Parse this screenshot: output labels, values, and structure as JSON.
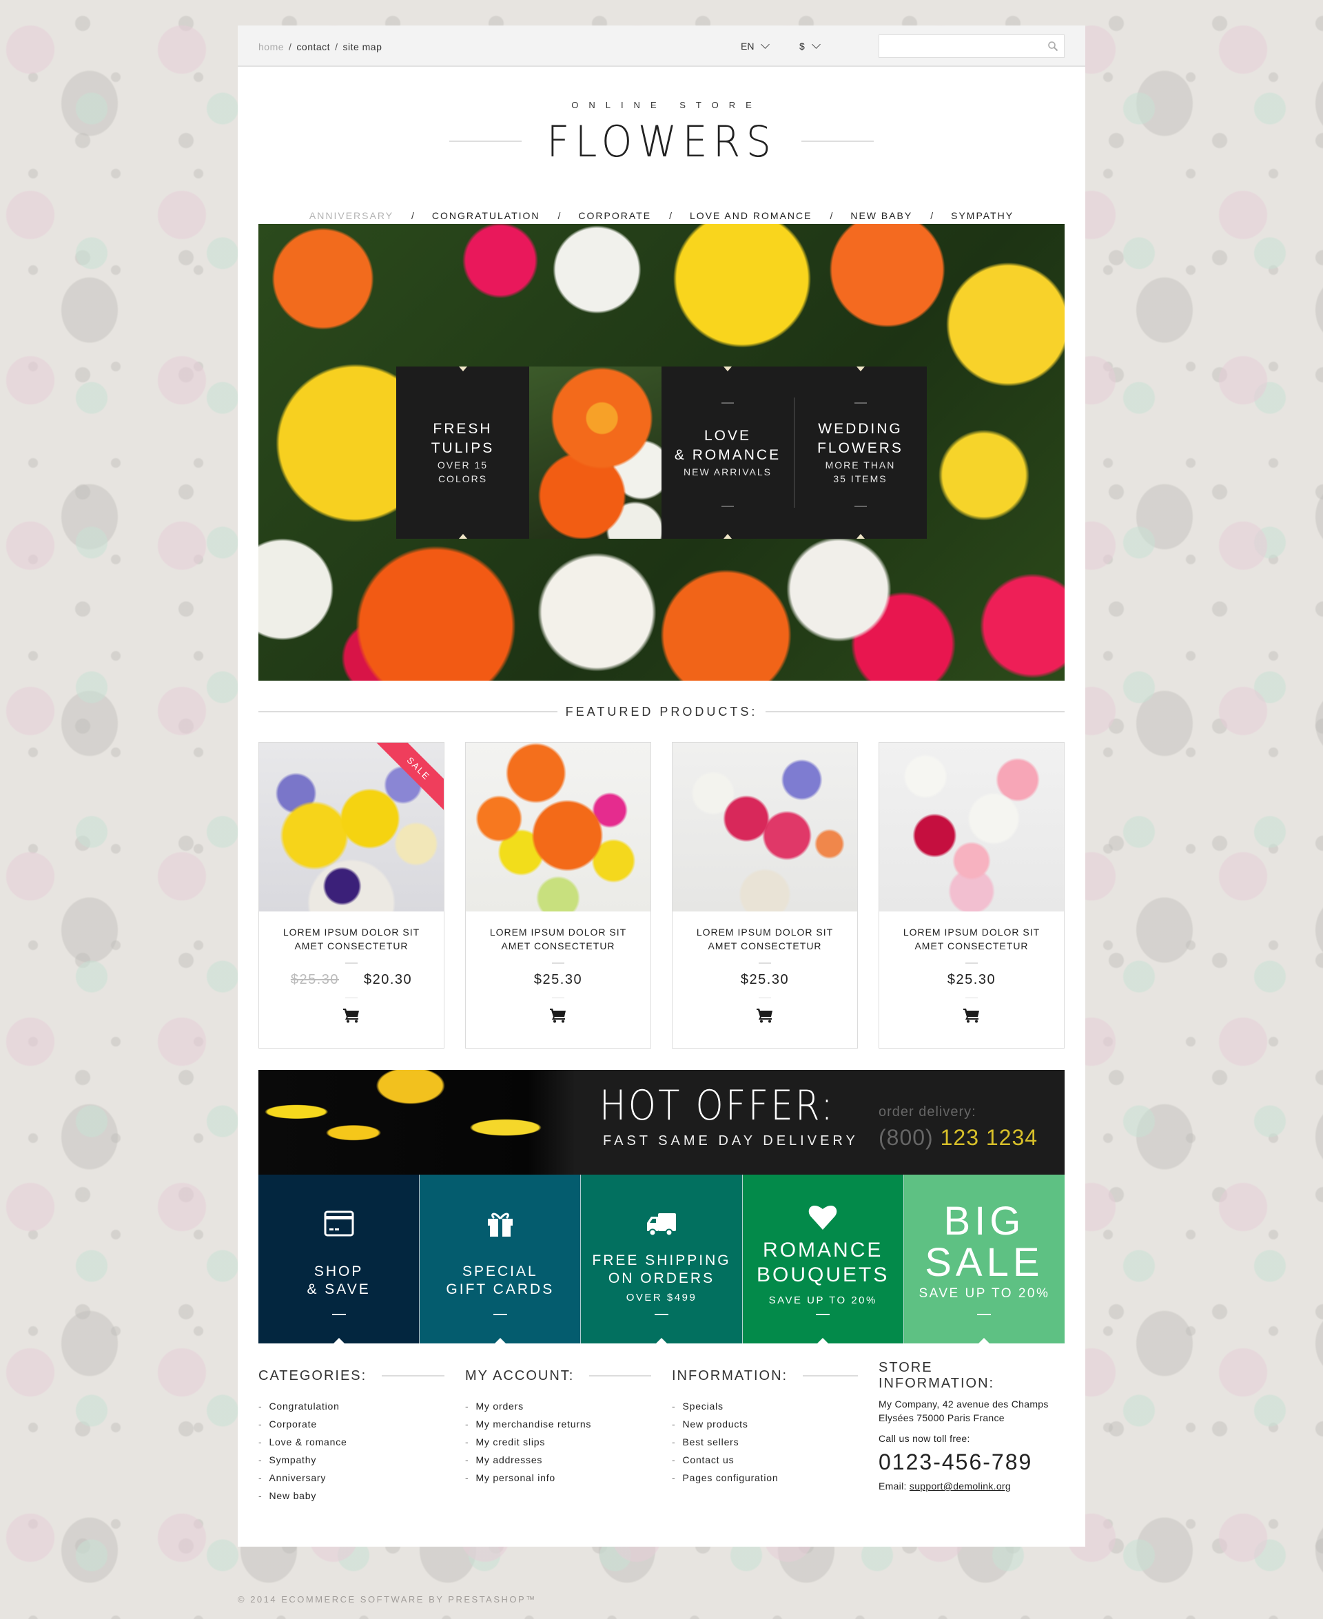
{
  "topbar": {
    "links": [
      {
        "label": "home",
        "active": true
      },
      {
        "label": "contact"
      },
      {
        "label": "site map"
      }
    ],
    "separator": "/",
    "language": "EN",
    "currency": "$",
    "search": {
      "value": "",
      "placeholder": ""
    }
  },
  "logo": {
    "subtitle": "ONLINE STORE",
    "title": "FLOWERS"
  },
  "nav": {
    "separator": "/",
    "items": [
      {
        "label": "ANNIVERSARY",
        "active": true
      },
      {
        "label": "CONGRATULATION"
      },
      {
        "label": "CORPORATE"
      },
      {
        "label": "LOVE AND ROMANCE"
      },
      {
        "label": "NEW BABY"
      },
      {
        "label": "SYMPATHY"
      }
    ]
  },
  "hero": {
    "banners": [
      {
        "title1": "FRESH",
        "title2": "TULIPS",
        "sub1": "OVER 15",
        "sub2": "COLORS"
      },
      {
        "title1": "LOVE",
        "title2": "& ROMANCE",
        "sub1": "NEW ARRIVALS",
        "sub2": ""
      },
      {
        "title1": "WEDDING",
        "title2": "FLOWERS",
        "sub1": "MORE THAN",
        "sub2": "35 ITEMS"
      }
    ]
  },
  "featured": {
    "title": "FEATURED PRODUCTS:",
    "products": [
      {
        "name1": "LOREM IPSUM DOLOR SIT",
        "name2": "AMET CONSECTETUR",
        "old_price": "$25.30",
        "price": "$20.30",
        "badge": "SALE"
      },
      {
        "name1": "LOREM IPSUM DOLOR SIT",
        "name2": "AMET CONSECTETUR",
        "price": "$25.30"
      },
      {
        "name1": "LOREM IPSUM DOLOR SIT",
        "name2": "AMET CONSECTETUR",
        "price": "$25.30"
      },
      {
        "name1": "LOREM IPSUM DOLOR SIT",
        "name2": "AMET CONSECTETUR",
        "price": "$25.30"
      }
    ]
  },
  "hot_offer": {
    "title": "HOT OFFER:",
    "subtitle": "FAST SAME DAY DELIVERY",
    "order_label": "order delivery:",
    "phone_area": "(800)",
    "phone_number": "123 1234",
    "phone_color": "#d8c02a"
  },
  "tiles": [
    {
      "icon": "credit-card-icon",
      "line1": "SHOP",
      "line2": "& SAVE",
      "sub": "",
      "color": "#03263f"
    },
    {
      "icon": "gift-icon",
      "line1": "SPECIAL",
      "line2": "GIFT CARDS",
      "sub": "",
      "color": "#045c6e"
    },
    {
      "icon": "truck-icon",
      "line1": "FREE SHIPPING",
      "line2": "ON ORDERS",
      "sub": "OVER $499",
      "color": "#02705f"
    },
    {
      "icon": "heart-icon",
      "line1": "ROMANCE",
      "line2": "BOUQUETS",
      "sub": "SAVE UP TO 20%",
      "color": "#038a4a"
    },
    {
      "icon": "",
      "line1": "BIG",
      "line2": "SALE",
      "sub": "SAVE UP TO 20%",
      "color": "#5ec183"
    }
  ],
  "footer": {
    "categories": {
      "title": "CATEGORIES:",
      "items": [
        "Congratulation",
        "Corporate",
        "Love & romance",
        "Sympathy",
        "Anniversary",
        "New baby"
      ]
    },
    "account": {
      "title": "MY ACCOUNT:",
      "items": [
        "My orders",
        "My merchandise returns",
        "My credit slips",
        "My addresses",
        "My personal info"
      ]
    },
    "information": {
      "title": "INFORMATION:",
      "items": [
        "Specials",
        "New products",
        "Best sellers",
        "Contact us",
        "Pages configuration"
      ]
    },
    "store": {
      "title": "STORE INFORMATION:",
      "address1": "My Company, 42 avenue des Champs",
      "address2": "Elysées 75000 Paris France",
      "call_label": "Call us now toll free:",
      "phone": "0123-456-789",
      "email_label": "Email:",
      "email": "support@demolink.org"
    }
  },
  "copyright": "© 2014 ECOMMERCE SOFTWARE BY PRESTASHOP™"
}
